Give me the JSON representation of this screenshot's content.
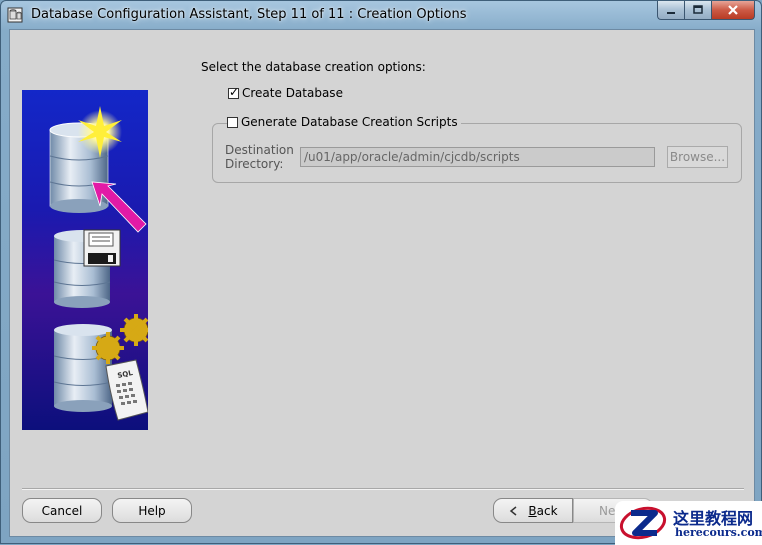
{
  "window": {
    "title": "Database Configuration Assistant, Step 11 of 11 : Creation Options",
    "min_icon": "minimize-icon",
    "max_icon": "maximize-icon",
    "close_icon": "close-icon"
  },
  "main": {
    "prompt": "Select the database creation options:",
    "create_database": {
      "label": "Create Database",
      "checked": true
    },
    "generate_scripts": {
      "label": "Generate Database Creation Scripts",
      "checked": false
    },
    "destination_label_line1": "Destination",
    "destination_label_line2": "Directory:",
    "destination_value": "/u01/app/oracle/admin/cjcdb/scripts",
    "browse_label": "Browse..."
  },
  "buttons": {
    "cancel": "Cancel",
    "help": "Help",
    "back_prefix": "",
    "back_mnemonic": "B",
    "back_rest": "ack",
    "next": "Next"
  },
  "watermark": {
    "cn": "这里教程网",
    "en": "herecours.com"
  },
  "colors": {
    "panel_bg": "#d4d4d4",
    "illustration_blue": "#1327c8",
    "arrow_magenta": "#e21aa6",
    "watermark_blue": "#0b2a8c"
  }
}
